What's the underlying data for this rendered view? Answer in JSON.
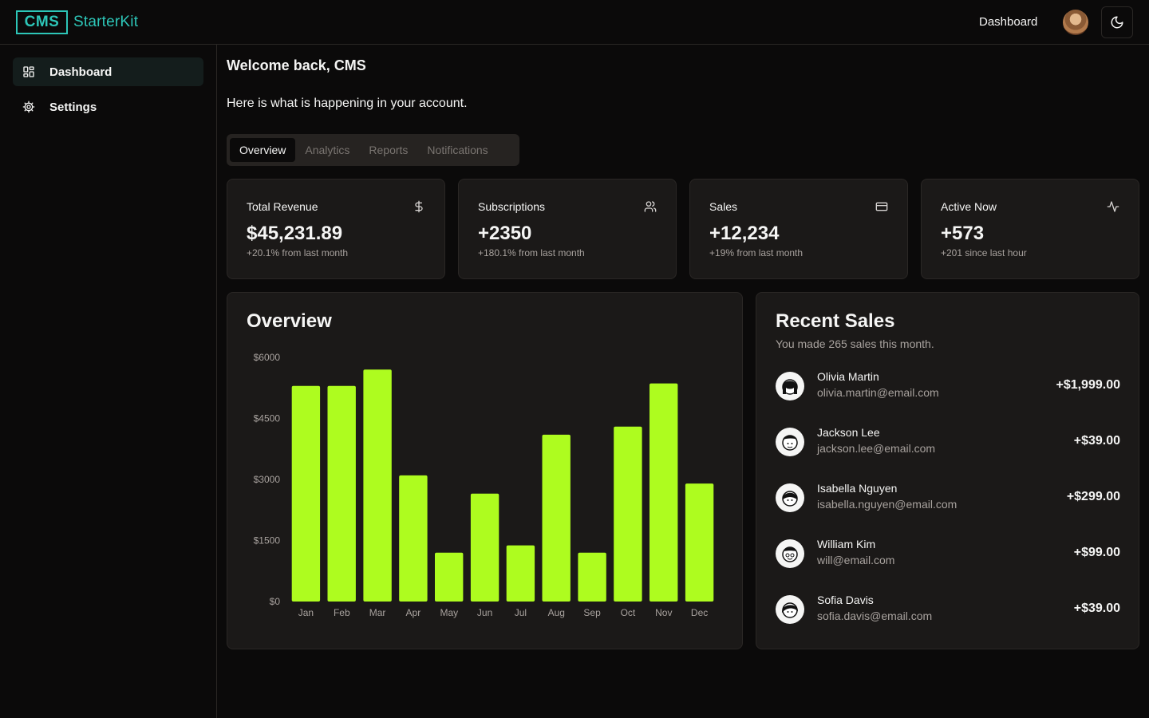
{
  "header": {
    "logo_box": "CMS",
    "logo_text": "StarterKit",
    "nav_link": "Dashboard",
    "theme_icon": "moon-icon"
  },
  "sidebar": {
    "items": [
      {
        "label": "Dashboard",
        "icon": "layout-grid-icon",
        "active": true
      },
      {
        "label": "Settings",
        "icon": "gear-icon",
        "active": false
      }
    ]
  },
  "main": {
    "welcome": "Welcome back, CMS",
    "subtitle": "Here is what is happening in your account.",
    "tabs": [
      {
        "label": "Overview",
        "active": true
      },
      {
        "label": "Analytics",
        "active": false
      },
      {
        "label": "Reports",
        "active": false
      },
      {
        "label": "Notifications",
        "active": false
      }
    ],
    "stats": [
      {
        "title": "Total Revenue",
        "value": "$45,231.89",
        "sub": "+20.1% from last month",
        "icon": "dollar-icon"
      },
      {
        "title": "Subscriptions",
        "value": "+2350",
        "sub": "+180.1% from last month",
        "icon": "users-icon"
      },
      {
        "title": "Sales",
        "value": "+12,234",
        "sub": "+19% from last month",
        "icon": "credit-card-icon"
      },
      {
        "title": "Active Now",
        "value": "+573",
        "sub": "+201 since last hour",
        "icon": "activity-icon"
      }
    ],
    "overview": {
      "title": "Overview"
    },
    "recent_sales": {
      "title": "Recent Sales",
      "subtitle": "You made 265 sales this month.",
      "items": [
        {
          "name": "Olivia Martin",
          "email": "olivia.martin@email.com",
          "amount": "+$1,999.00"
        },
        {
          "name": "Jackson Lee",
          "email": "jackson.lee@email.com",
          "amount": "+$39.00"
        },
        {
          "name": "Isabella Nguyen",
          "email": "isabella.nguyen@email.com",
          "amount": "+$299.00"
        },
        {
          "name": "William Kim",
          "email": "will@email.com",
          "amount": "+$99.00"
        },
        {
          "name": "Sofia Davis",
          "email": "sofia.davis@email.com",
          "amount": "+$39.00"
        }
      ]
    }
  },
  "colors": {
    "background": "#0b0a0a",
    "card": "#1b1918",
    "border": "#2a2725",
    "accent_bar": "#aefc1f",
    "logo": "#2dc6b8",
    "muted_text": "#a8a29e"
  },
  "chart_data": {
    "type": "bar",
    "categories": [
      "Jan",
      "Feb",
      "Mar",
      "Apr",
      "May",
      "Jun",
      "Jul",
      "Aug",
      "Sep",
      "Oct",
      "Nov",
      "Dec"
    ],
    "values": [
      5300,
      5300,
      5700,
      3100,
      1200,
      2650,
      1380,
      4100,
      1200,
      4300,
      5360,
      2900
    ],
    "yticks": [
      "$0",
      "$1500",
      "$3000",
      "$4500",
      "$6000"
    ],
    "ylim": [
      0,
      6000
    ],
    "grid": false,
    "bar_color": "#aefc1f"
  }
}
